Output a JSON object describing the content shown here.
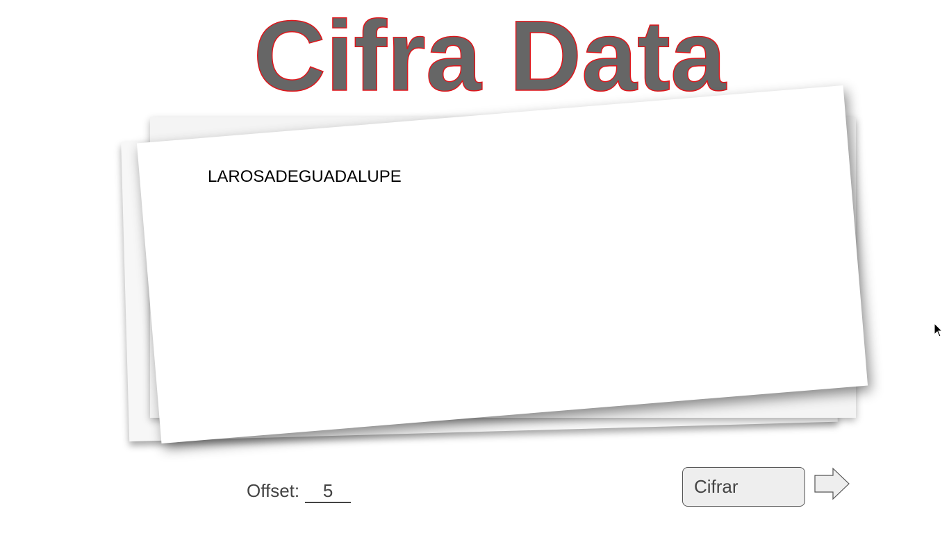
{
  "app": {
    "title": "Cifra Data"
  },
  "message": {
    "text": "LAROSADEGUADALUPE"
  },
  "offset": {
    "label": "Offset:",
    "value": "5"
  },
  "actions": {
    "cipher_label": "Cifrar",
    "next_icon": "arrow-right-icon"
  },
  "colors": {
    "title_fill": "#666666",
    "title_stroke": "#e0161b",
    "button_bg": "#eeeeee"
  }
}
